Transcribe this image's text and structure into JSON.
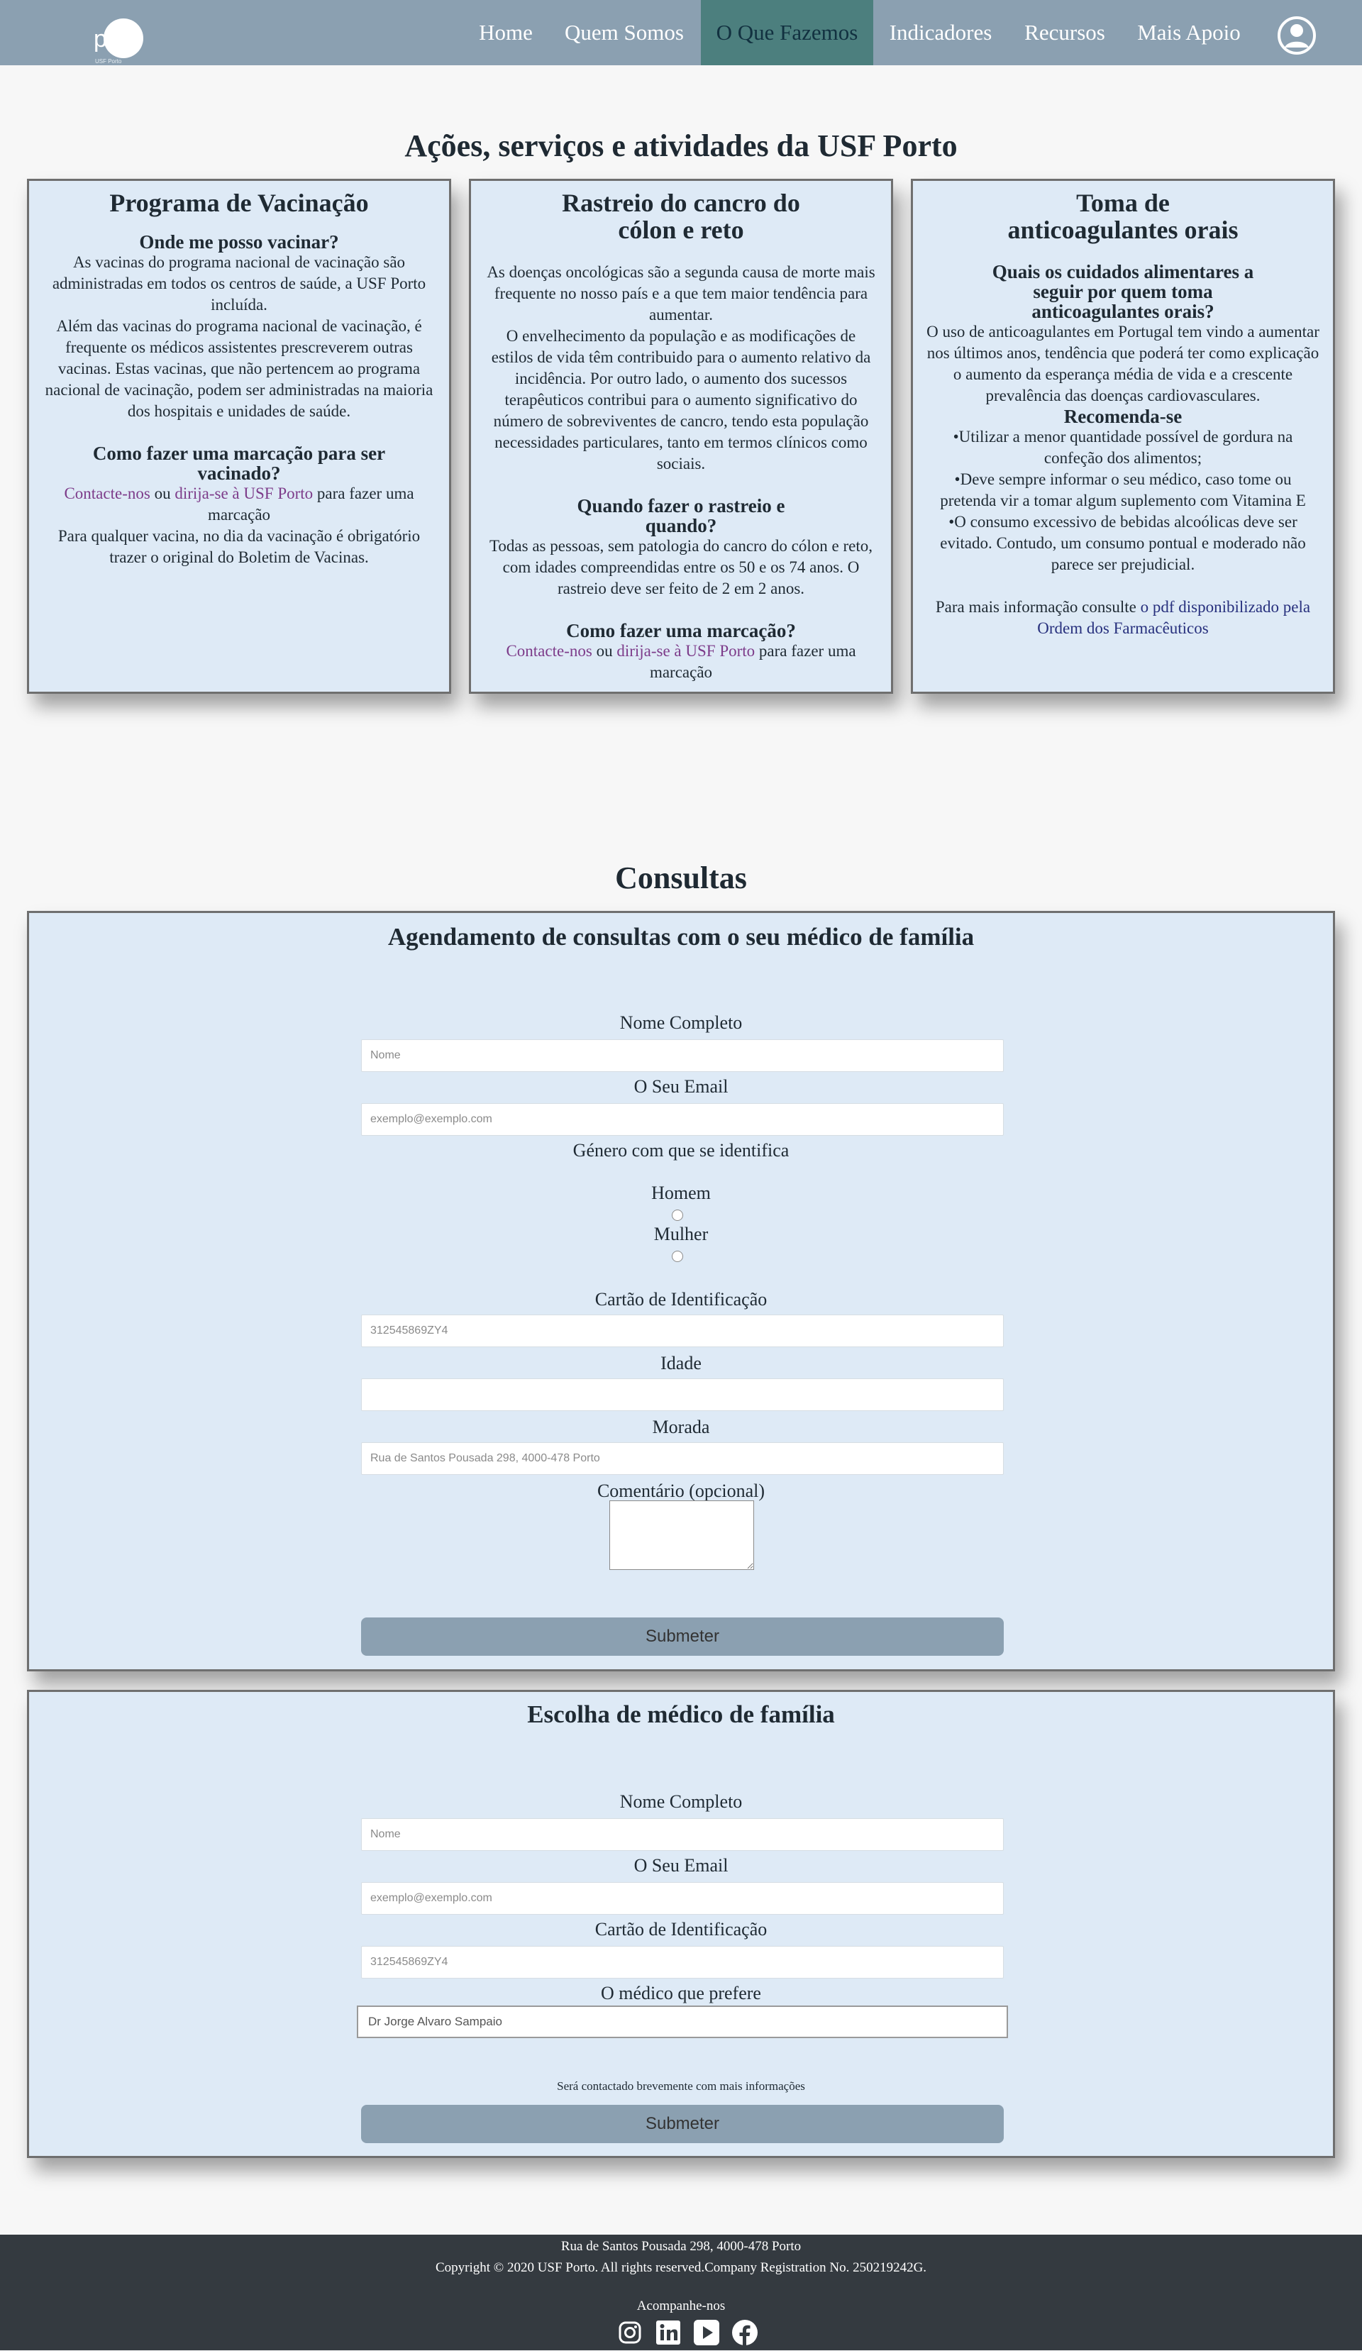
{
  "nav": {
    "logo_text": "pc",
    "logo_sub": "USF Porto",
    "items": [
      {
        "label": "Home"
      },
      {
        "label": "Quem Somos"
      },
      {
        "label": "O Que Fazemos"
      },
      {
        "label": "Indicadores"
      },
      {
        "label": "Recursos"
      },
      {
        "label": "Mais Apoio"
      }
    ],
    "active_item": "O Que Fazemos",
    "profile_icon": "user-circle-icon"
  },
  "actions": {
    "title": "Ações, serviços e atividades da USF Porto",
    "cards": [
      {
        "title": "Programa de Vacinação",
        "q1": "Onde me posso vacinar?",
        "p1": "As vacinas do programa nacional de vacinação são administradas em todos os centros de saúde, a USF Porto incluída.",
        "p2": "Além das vacinas do programa nacional de vacinação, é frequente os médicos assistentes prescreverem outras vacinas. Estas vacinas, que não pertencem ao programa nacional de vacinação, podem ser administradas na maioria dos hospitais e unidades de saúde.",
        "q2": "Como fazer uma marcação para ser vacinado?",
        "contact_link": "Contacte-nos",
        "or": "ou",
        "visit_link": "dirija-se à USF Porto",
        "after": "para fazer uma marcação",
        "p3": "Para qualquer vacina, no dia da vacinação é obrigatório trazer o original do Boletim de Vacinas."
      },
      {
        "title": "Rastreio do cancro do cólon e reto",
        "p1": "As doenças oncológicas são a segunda causa de morte mais frequente no nosso país e a que tem maior tendência para aumentar.",
        "p2": "O envelhecimento da população e as modificações de estilos de vida têm contribuido para o aumento relativo da incidência. Por outro lado, o aumento dos sucessos terapêuticos contribui para o aumento significativo do número de sobreviventes de cancro, tendo esta população necessidades particulares, tanto em termos clínicos como sociais.",
        "q1": "Quando fazer o rastreio e quando?",
        "p3": "Todas as pessoas, sem patologia do cancro do cólon e reto, com idades compreendidas entre os 50 e os 74 anos. O rastreio deve ser feito de 2 em 2 anos.",
        "q2": "Como fazer uma marcação?",
        "contact_link": "Contacte-nos",
        "or": "ou",
        "visit_link": "dirija-se à USF Porto",
        "after": "para fazer uma marcação"
      },
      {
        "title": "Toma de anticoagulantes orais",
        "q1": "Quais os cuidados alimentares a seguir por quem toma anticoagulantes orais?",
        "p1": "O uso de anticoagulantes em Portugal tem vindo a aumentar nos últimos anos, tendência que poderá ter como explicação o aumento da esperança média de vida e a crescente prevalência das doenças cardiovasculares.",
        "q2": "Recomenda-se",
        "b1": "•Utilizar a menor quantidade possível de gordura na confeção dos alimentos;",
        "b2": "•Deve sempre informar o seu médico, caso tome ou pretenda vir a tomar algum suplemento com Vitamina E",
        "b3": "•O consumo excessivo de bebidas alcoólicas deve ser evitado. Contudo, um consumo pontual e moderado não parece ser prejudicial.",
        "more": "Para mais informação consulte",
        "more_link": "o pdf disponibilizado pela Ordem dos Farmacêuticos"
      }
    ]
  },
  "consultas": {
    "title": "Consultas",
    "appointment": {
      "title": "Agendamento de consultas com o seu médico de família",
      "name_label": "Nome Completo",
      "name_placeholder": "Nome",
      "email_label": "O Seu Email",
      "email_placeholder": "exemplo@exemplo.com",
      "gender_label": "Género com que se identifica",
      "gender_options": [
        "Homem",
        "Mulher"
      ],
      "id_label": "Cartão de Identificação",
      "id_placeholder": "312545869ZY4",
      "age_label": "Idade",
      "address_label": "Morada",
      "address_placeholder": "Rua de Santos Pousada 298, 4000-478 Porto",
      "comment_label": "Comentário (opcional)",
      "submit": "Submeter"
    },
    "doctor": {
      "title": "Escolha de médico de família",
      "name_label": "Nome Completo",
      "name_placeholder": "Nome",
      "email_label": "O Seu Email",
      "email_placeholder": "exemplo@exemplo.com",
      "id_label": "Cartão de Identificação",
      "id_placeholder": "312545869ZY4",
      "doctor_label": "O médico que prefere",
      "doctor_selected": "Dr Jorge Alvaro Sampaio",
      "note": "Será contactado brevemente com mais informações",
      "submit": "Submeter"
    }
  },
  "footer": {
    "address": "Rua de Santos Pousada 298, 4000-478 Porto",
    "copyright": "Copyright © 2020 USF Porto. All rights reserved.Company Registration No. 250219242G.",
    "follow": "Acompanhe-nos",
    "social": [
      "instagram-icon",
      "linkedin-icon",
      "youtube-icon",
      "facebook-icon"
    ]
  },
  "colors": {
    "navbar": "#8ba0b1",
    "nav_active": "#4c7f7e",
    "card_bg": "#deeaf6",
    "footer": "#343a40",
    "link_purple": "#7d3c8a",
    "link_blue": "#27307d",
    "submit": "#8ba0b1"
  }
}
